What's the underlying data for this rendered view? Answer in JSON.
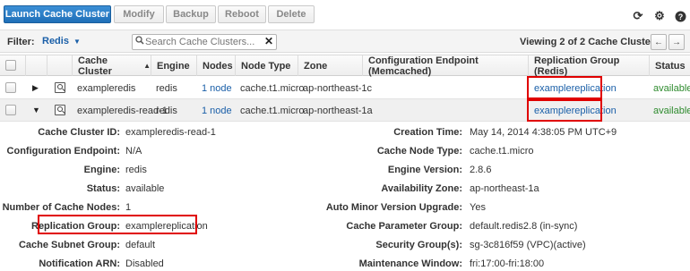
{
  "toolbar": {
    "launch_label": "Launch Cache Cluster",
    "modify_label": "Modify",
    "backup_label": "Backup",
    "reboot_label": "Reboot",
    "delete_label": "Delete"
  },
  "filter": {
    "label": "Filter:",
    "selected": "Redis",
    "search_placeholder": "Search Cache Clusters...",
    "viewing_text": "Viewing 2 of 2 Cache Clusters"
  },
  "table": {
    "headers": {
      "cache_cluster": "Cache Cluster",
      "engine": "Engine",
      "nodes": "Nodes",
      "node_type": "Node Type",
      "zone": "Zone",
      "config_endpoint": "Configuration Endpoint (Memcached)",
      "replication_group": "Replication Group (Redis)",
      "status": "Status"
    },
    "rows": [
      {
        "cache_cluster": "exampleredis",
        "engine": "redis",
        "nodes": "1 node",
        "node_type": "cache.t1.micro",
        "zone": "ap-northeast-1c",
        "config_endpoint": "",
        "replication_group": "examplereplication",
        "status": "available"
      },
      {
        "cache_cluster": "exampleredis-read-1",
        "engine": "redis",
        "nodes": "1 node",
        "node_type": "cache.t1.micro",
        "zone": "ap-northeast-1a",
        "config_endpoint": "",
        "replication_group": "examplereplication",
        "status": "available"
      }
    ]
  },
  "details": {
    "left": [
      {
        "label": "Cache Cluster ID:",
        "value": "exampleredis-read-1"
      },
      {
        "label": "Configuration Endpoint:",
        "value": "N/A"
      },
      {
        "label": "Engine:",
        "value": "redis"
      },
      {
        "label": "Status:",
        "value": "available"
      },
      {
        "label": "Number of Cache Nodes:",
        "value": "1"
      },
      {
        "label": "Replication Group:",
        "value": "examplereplication"
      },
      {
        "label": "Cache Subnet Group:",
        "value": "default"
      },
      {
        "label": "Notification ARN:",
        "value": "Disabled"
      }
    ],
    "right": [
      {
        "label": "Creation Time:",
        "value": "May 14, 2014 4:38:05 PM UTC+9"
      },
      {
        "label": "Cache Node Type:",
        "value": "cache.t1.micro"
      },
      {
        "label": "Engine Version:",
        "value": "2.8.6"
      },
      {
        "label": "Availability Zone:",
        "value": "ap-northeast-1a"
      },
      {
        "label": "Auto Minor Version Upgrade:",
        "value": "Yes"
      },
      {
        "label": "Cache Parameter Group:",
        "value": "default.redis2.8 (in-sync)"
      },
      {
        "label": "Security Group(s):",
        "value": "sg-3c816f59 (VPC)(active)"
      },
      {
        "label": "Maintenance Window:",
        "value": "fri:17:00-fri:18:00"
      }
    ]
  },
  "icons": {
    "refresh": "refresh-icon",
    "settings": "gear-icon",
    "help": "help-icon"
  },
  "colors": {
    "primary": "#1f6fb8",
    "link": "#1a5fa8",
    "available": "#2e8b2e",
    "highlight": "#e00000"
  }
}
